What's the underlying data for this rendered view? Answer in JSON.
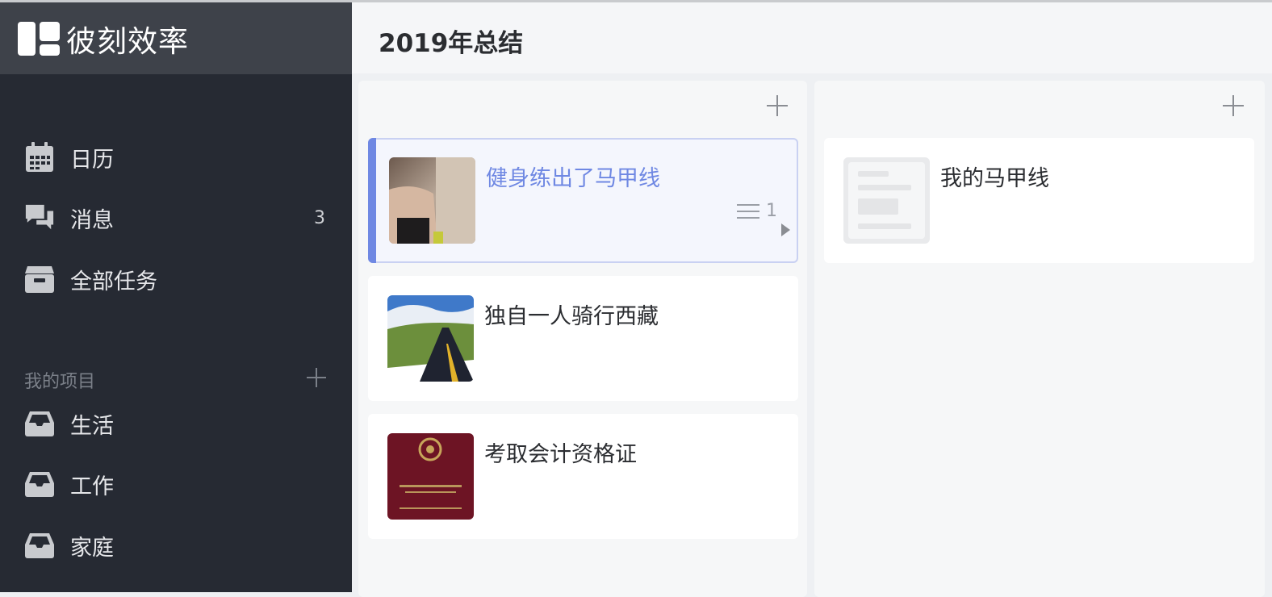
{
  "app": {
    "brand": "彼刻效率"
  },
  "sidebar": {
    "nav": [
      {
        "label": "日历",
        "icon": "calendar-icon",
        "badge": ""
      },
      {
        "label": "消息",
        "icon": "chat-bubbles-icon",
        "badge": "3"
      },
      {
        "label": "全部任务",
        "icon": "archive-box-icon",
        "badge": ""
      }
    ],
    "projects_title": "我的项目",
    "projects": [
      {
        "label": "生活",
        "icon": "inbox-tray-icon"
      },
      {
        "label": "工作",
        "icon": "inbox-tray-icon"
      },
      {
        "label": "家庭",
        "icon": "inbox-tray-icon"
      }
    ]
  },
  "main": {
    "title": "2019年总结",
    "columns": [
      {
        "cards": [
          {
            "title": "健身练出了马甲线",
            "comments": "1",
            "active": true,
            "thumb": "abs-photo"
          },
          {
            "title": "独自一人骑行西藏",
            "active": false,
            "thumb": "road-photo"
          },
          {
            "title": "考取会计资格证",
            "active": false,
            "thumb": "certificate-photo"
          }
        ]
      },
      {
        "cards": [
          {
            "title": "我的马甲线",
            "active": false,
            "thumb": "document-placeholder"
          }
        ]
      }
    ]
  },
  "colors": {
    "sidebar_bg": "#262a33",
    "brand_bg": "#3e424a",
    "accent": "#6f88e3"
  }
}
